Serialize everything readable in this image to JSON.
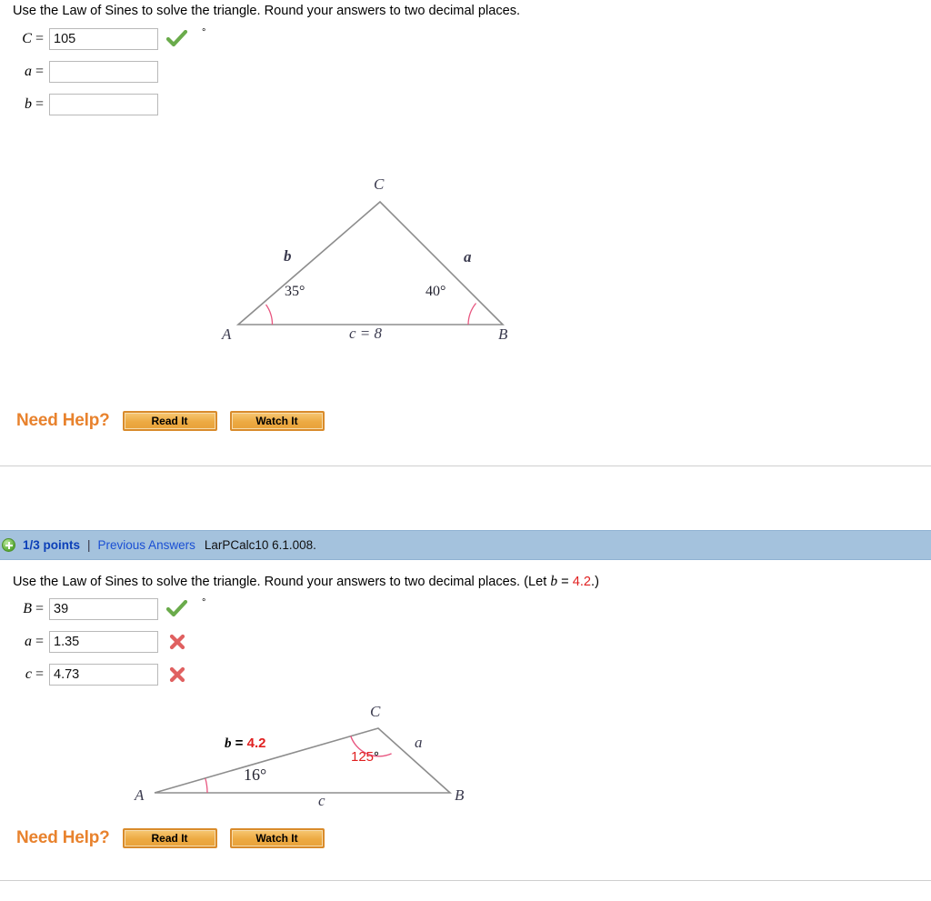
{
  "question1": {
    "prompt_text": "Use the Law of Sines to solve the triangle. Round your answers to two decimal places.",
    "answers": [
      {
        "label": "C",
        "value": "105",
        "mark": "check-icon",
        "degree": "°"
      },
      {
        "label": "a",
        "value": "",
        "mark": "none",
        "degree": ""
      },
      {
        "label": "b",
        "value": "",
        "mark": "none",
        "degree": ""
      }
    ],
    "figure": {
      "vertices": {
        "A": "A",
        "B": "B",
        "C": "C"
      },
      "side_b": "b",
      "side_a": "a",
      "side_c": "c  = 8",
      "angle_A": "35°",
      "angle_B": "40°"
    },
    "need_help": {
      "label": "Need Help?",
      "read_it": "Read It",
      "watch_it": "Watch It"
    }
  },
  "question2": {
    "scorebar": {
      "icon": "plus-circle-icon",
      "points": "1/3 points",
      "separator": "|",
      "previous_answers": "Previous Answers",
      "code": "LarPCalc10 6.1.008."
    },
    "prompt_prefix": "Use the Law of Sines to solve the triangle. Round your answers to two decimal places. (Let ",
    "prompt_var": "b",
    "prompt_eq": " = ",
    "prompt_given": "4.2",
    "prompt_suffix": ".)",
    "answers": [
      {
        "label": "B",
        "value": "39",
        "mark": "check-icon",
        "degree": "°"
      },
      {
        "label": "a",
        "value": "1.35",
        "mark": "cross-icon",
        "degree": ""
      },
      {
        "label": "c",
        "value": "4.73",
        "mark": "cross-icon",
        "degree": ""
      }
    ],
    "figure": {
      "vertices": {
        "A": "A",
        "B": "B",
        "C": "C"
      },
      "side_b_prefix": "b",
      "side_b_eq": " = ",
      "side_b_value": "4.2",
      "side_a": "a",
      "side_c": "c",
      "angle_A": "16°",
      "angle_C_value": "125",
      "angle_C_deg": "°"
    },
    "need_help": {
      "label": "Need Help?",
      "read_it": "Read It",
      "watch_it": "Watch It"
    }
  },
  "colors": {
    "scorebar_blue": "#a4c2dd",
    "accent_orange": "#e8822d",
    "correct_green": "#6aab4b",
    "incorrect_red": "#e06060",
    "given_red": "#e02020",
    "arc_pink": "#e8557f"
  }
}
